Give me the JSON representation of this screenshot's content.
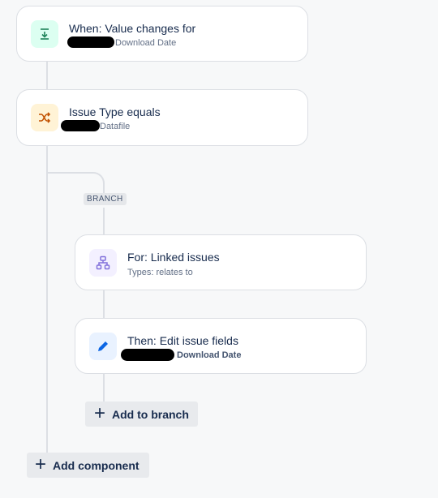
{
  "trigger": {
    "title": "When: Value changes for",
    "field": "Download Date",
    "icon": "download-icon",
    "icon_color": "#1f845a",
    "icon_bg": "#dcfff1"
  },
  "condition": {
    "title": "Issue Type equals",
    "value": "Datafile",
    "icon": "shuffle-icon",
    "icon_color": "#c25100",
    "icon_bg": "#fff3d6"
  },
  "branch": {
    "label": "BRANCH",
    "for_card": {
      "title": "For: Linked issues",
      "subtitle": "Types: relates to",
      "icon": "hierarchy-icon",
      "icon_color": "#8270db",
      "icon_bg": "#f3f0ff"
    },
    "action_card": {
      "title": "Then: Edit issue fields",
      "field": "Download Date",
      "icon": "pencil-icon",
      "icon_color": "#0c66e4",
      "icon_bg": "#e9f2ff"
    },
    "add_to_branch_label": "Add to branch"
  },
  "add_component_label": "Add component",
  "colors": {
    "background": "#f7f8f9",
    "connector": "#dcdfe4",
    "card_border": "#dcdfe4",
    "button_bg": "#e8eaed"
  }
}
